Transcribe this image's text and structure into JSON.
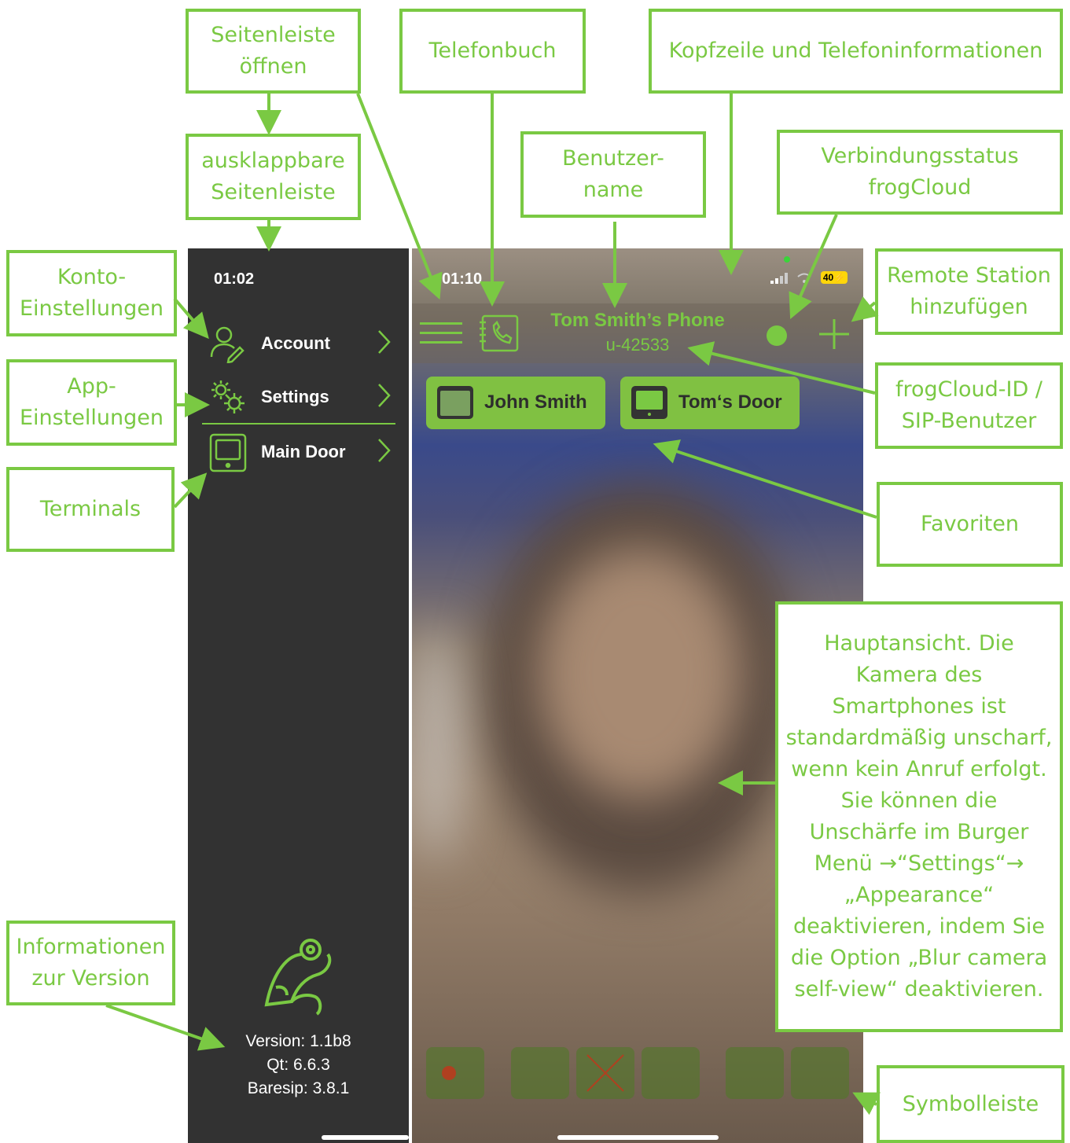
{
  "left_screen": {
    "time": "01:02",
    "menu": [
      {
        "label": "Account",
        "icon": "account-icon"
      },
      {
        "label": "Settings",
        "icon": "gears-icon"
      },
      {
        "label": "Main Door",
        "icon": "terminal-icon"
      }
    ],
    "version": "Version: 1.1b8",
    "qt": "Qt: 6.6.3",
    "baresip": "Baresip: 3.8.1"
  },
  "right_screen": {
    "time": "01:10",
    "battery": "40",
    "phone_name": "Tom Smith’s Phone",
    "user_id": "u-42533",
    "favorites": [
      "John Smith",
      "Tom‘s Door"
    ]
  },
  "callouts": {
    "sidebar_open": "Seitenleiste\nöffnen",
    "phonebook": "Telefonbuch",
    "header": "Kopfzeile und Telefoninformationen",
    "collapsible_sidebar": "ausklappbare\nSeitenleiste",
    "username": "Benutzer-\nname",
    "connection_status": "Verbindungsstatus\nfrogCloud",
    "account_settings": "Konto-\nEinstellungen",
    "add_remote": "Remote Station\nhinzufügen",
    "app_settings": "App-\nEinstellungen",
    "frogcloud_id": "frogCloud-ID /\nSIP-Benutzer",
    "terminals": "Terminals",
    "favorites": "Favoriten",
    "main_view": "Hauptansicht. Die\nKamera des\nSmartphones ist\nstandardmäßig unscharf,\nwenn kein Anruf erfolgt.\nSie können die\nUnschärfe im Burger\nMenü →“Settings“→\n„Appearance“\ndeaktivieren, indem Sie\ndie Option „Blur camera\nself-view“ deaktivieren.",
    "version_info": "Informationen\nzur Version",
    "toolbar": "Symbolleiste"
  },
  "colors": {
    "accent": "#7ac943",
    "sidebar_bg": "#323232",
    "fav_bg": "#80c142"
  }
}
